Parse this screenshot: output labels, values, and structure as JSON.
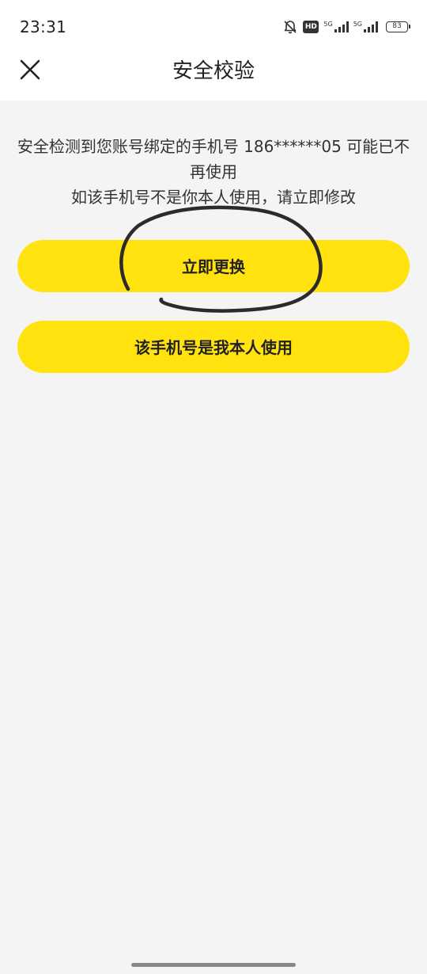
{
  "status_bar": {
    "time": "23:31",
    "hd_badge": "HD",
    "network_1": "5G",
    "network_2": "5G",
    "battery": "83"
  },
  "header": {
    "title": "安全校验",
    "close_icon": "close-icon"
  },
  "message": {
    "line1": "安全检测到您账号绑定的手机号 186******05 可能已不",
    "line2": "再使用",
    "line3": "如该手机号不是你本人使用，请立即修改"
  },
  "buttons": {
    "change_now": "立即更换",
    "is_mine": "该手机号是我本人使用"
  },
  "colors": {
    "accent_yellow": "#ffe20e",
    "background": "#f4f4f4",
    "header_background": "#ffffff",
    "annotation_stroke": "#2b2b2b"
  },
  "annotation": {
    "type": "hand-drawn circle around primary button"
  }
}
